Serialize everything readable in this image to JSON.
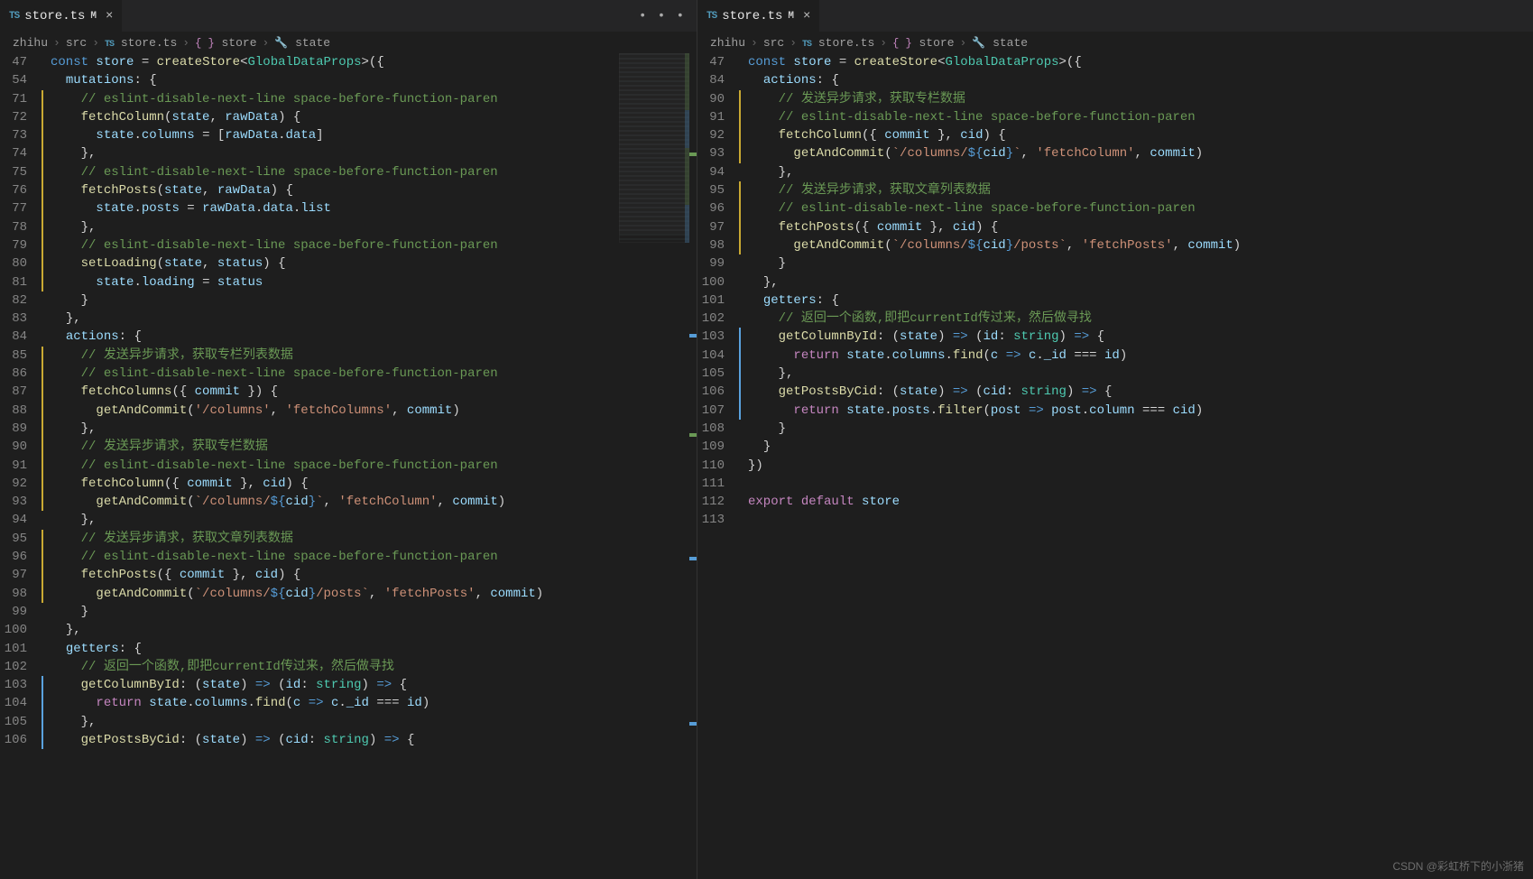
{
  "watermark": "CSDN @彩虹桥下的小浙猪",
  "left": {
    "tab": {
      "icon": "TS",
      "name": "store.ts",
      "modified": "M",
      "close": "×"
    },
    "tab_actions": "• • •",
    "breadcrumb": [
      "zhihu",
      "src",
      {
        "icon": "TS",
        "text": "store.ts"
      },
      {
        "sym": "{}",
        "text": "store"
      },
      {
        "sym": "🔧",
        "text": "state"
      }
    ],
    "lines": [
      {
        "n": 47,
        "stripe": "",
        "html": "<span class='def'>const</span> <span class='var'>store</span> <span class='op'>=</span> <span class='fn'>createStore</span><span class='pun'>&lt;</span><span class='type'>GlobalDataProps</span><span class='pun'>&gt;(</span><span class='pun'>{</span>"
      },
      {
        "n": 54,
        "stripe": "",
        "html": "  <span class='var'>mutations</span><span class='pun'>:</span> <span class='pun'>{</span>"
      },
      {
        "n": 71,
        "stripe": "y",
        "html": "    <span class='cmt'>// eslint-disable-next-line space-before-function-paren</span>"
      },
      {
        "n": 72,
        "stripe": "y",
        "html": "    <span class='fn'>fetchColumn</span><span class='pun'>(</span><span class='var'>state</span><span class='pun'>,</span> <span class='var'>rawData</span><span class='pun'>) {</span>"
      },
      {
        "n": 73,
        "stripe": "y",
        "html": "      <span class='var'>state</span><span class='pun'>.</span><span class='var'>columns</span> <span class='op'>=</span> <span class='pun'>[</span><span class='var'>rawData</span><span class='pun'>.</span><span class='var'>data</span><span class='pun'>]</span>"
      },
      {
        "n": 74,
        "stripe": "y",
        "html": "    <span class='pun'>},</span>"
      },
      {
        "n": 75,
        "stripe": "y",
        "html": "    <span class='cmt'>// eslint-disable-next-line space-before-function-paren</span>"
      },
      {
        "n": 76,
        "stripe": "y",
        "html": "    <span class='fn'>fetchPosts</span><span class='pun'>(</span><span class='var'>state</span><span class='pun'>,</span> <span class='var'>rawData</span><span class='pun'>) {</span>"
      },
      {
        "n": 77,
        "stripe": "y",
        "html": "      <span class='var'>state</span><span class='pun'>.</span><span class='var'>posts</span> <span class='op'>=</span> <span class='var'>rawData</span><span class='pun'>.</span><span class='var'>data</span><span class='pun'>.</span><span class='var'>list</span>"
      },
      {
        "n": 78,
        "stripe": "y",
        "html": "    <span class='pun'>},</span>"
      },
      {
        "n": 79,
        "stripe": "y",
        "html": "    <span class='cmt'>// eslint-disable-next-line space-before-function-paren</span>"
      },
      {
        "n": 80,
        "stripe": "y",
        "html": "    <span class='fn'>setLoading</span><span class='pun'>(</span><span class='var'>state</span><span class='pun'>,</span> <span class='var'>status</span><span class='pun'>) {</span>"
      },
      {
        "n": 81,
        "stripe": "y",
        "html": "      <span class='var'>state</span><span class='pun'>.</span><span class='var'>loading</span> <span class='op'>=</span> <span class='var'>status</span>"
      },
      {
        "n": 82,
        "stripe": "",
        "html": "    <span class='pun'>}</span>"
      },
      {
        "n": 83,
        "stripe": "",
        "html": "  <span class='pun'>},</span>"
      },
      {
        "n": 84,
        "stripe": "",
        "html": "  <span class='var'>actions</span><span class='pun'>:</span> <span class='pun'>{</span>"
      },
      {
        "n": 85,
        "stripe": "y",
        "html": "    <span class='cmt'>// 发送异步请求，获取专栏列表数据</span>"
      },
      {
        "n": 86,
        "stripe": "y",
        "html": "    <span class='cmt'>// eslint-disable-next-line space-before-function-paren</span>"
      },
      {
        "n": 87,
        "stripe": "y",
        "html": "    <span class='fn'>fetchColumns</span><span class='pun'>({ </span><span class='var'>commit</span><span class='pun'> }) {</span>"
      },
      {
        "n": 88,
        "stripe": "y",
        "html": "      <span class='fn'>getAndCommit</span><span class='pun'>(</span><span class='str'>'/columns'</span><span class='pun'>,</span> <span class='str'>'fetchColumns'</span><span class='pun'>,</span> <span class='var'>commit</span><span class='pun'>)</span>"
      },
      {
        "n": 89,
        "stripe": "y",
        "html": "    <span class='pun'>},</span>"
      },
      {
        "n": 90,
        "stripe": "y",
        "html": "    <span class='cmt'>// 发送异步请求，获取专栏数据</span>"
      },
      {
        "n": 91,
        "stripe": "y",
        "html": "    <span class='cmt'>// eslint-disable-next-line space-before-function-paren</span>"
      },
      {
        "n": 92,
        "stripe": "y",
        "html": "    <span class='fn'>fetchColumn</span><span class='pun'>({ </span><span class='var'>commit</span><span class='pun'> }, </span><span class='var'>cid</span><span class='pun'>) {</span>"
      },
      {
        "n": 93,
        "stripe": "y",
        "html": "      <span class='fn'>getAndCommit</span><span class='pun'>(</span><span class='str'>`/columns/</span><span class='def'>${</span><span class='var'>cid</span><span class='def'>}</span><span class='str'>`</span><span class='pun'>,</span> <span class='str'>'fetchColumn'</span><span class='pun'>,</span> <span class='var'>commit</span><span class='pun'>)</span>"
      },
      {
        "n": 94,
        "stripe": "",
        "html": "    <span class='pun'>},</span>"
      },
      {
        "n": 95,
        "stripe": "y",
        "html": "    <span class='cmt'>// 发送异步请求，获取文章列表数据</span>"
      },
      {
        "n": 96,
        "stripe": "y",
        "html": "    <span class='cmt'>// eslint-disable-next-line space-before-function-paren</span>"
      },
      {
        "n": 97,
        "stripe": "y",
        "html": "    <span class='fn'>fetchPosts</span><span class='pun'>({ </span><span class='var'>commit</span><span class='pun'> }, </span><span class='var'>cid</span><span class='pun'>) {</span>"
      },
      {
        "n": 98,
        "stripe": "y",
        "html": "      <span class='fn'>getAndCommit</span><span class='pun'>(</span><span class='str'>`/columns/</span><span class='def'>${</span><span class='var'>cid</span><span class='def'>}</span><span class='str'>/posts`</span><span class='pun'>,</span> <span class='str'>'fetchPosts'</span><span class='pun'>,</span> <span class='var'>commit</span><span class='pun'>)</span>"
      },
      {
        "n": 99,
        "stripe": "",
        "html": "    <span class='pun'>}</span>"
      },
      {
        "n": 100,
        "stripe": "",
        "html": "  <span class='pun'>},</span>"
      },
      {
        "n": 101,
        "stripe": "",
        "html": "  <span class='var'>getters</span><span class='pun'>:</span> <span class='pun'>{</span>"
      },
      {
        "n": 102,
        "stripe": "",
        "html": "    <span class='cmt'>// 返回一个函数,即把currentId传过来，然后做寻找</span>"
      },
      {
        "n": 103,
        "stripe": "b",
        "html": "    <span class='fn'>getColumnById</span><span class='pun'>:</span> <span class='pun'>(</span><span class='var'>state</span><span class='pun'>)</span> <span class='def'>=&gt;</span> <span class='pun'>(</span><span class='var'>id</span><span class='pun'>:</span> <span class='type'>string</span><span class='pun'>)</span> <span class='def'>=&gt;</span> <span class='pun'>{</span>"
      },
      {
        "n": 104,
        "stripe": "b",
        "html": "      <span class='kw'>return</span> <span class='var'>state</span><span class='pun'>.</span><span class='var'>columns</span><span class='pun'>.</span><span class='fn'>find</span><span class='pun'>(</span><span class='var'>c</span> <span class='def'>=&gt;</span> <span class='var'>c</span><span class='pun'>.</span><span class='var'>_id</span> <span class='op'>===</span> <span class='var'>id</span><span class='pun'>)</span>"
      },
      {
        "n": 105,
        "stripe": "b",
        "html": "    <span class='pun'>},</span>"
      },
      {
        "n": 106,
        "stripe": "b",
        "html": "    <span class='fn'>getPostsByCid</span><span class='pun'>:</span> <span class='pun'>(</span><span class='var'>state</span><span class='pun'>)</span> <span class='def'>=&gt;</span> <span class='pun'>(</span><span class='var'>cid</span><span class='pun'>:</span> <span class='type'>string</span><span class='pun'>)</span> <span class='def'>=&gt;</span> <span class='pun'>{</span>"
      }
    ]
  },
  "right": {
    "tab": {
      "icon": "TS",
      "name": "store.ts",
      "modified": "M",
      "close": "×"
    },
    "breadcrumb": [
      "zhihu",
      "src",
      {
        "icon": "TS",
        "text": "store.ts"
      },
      {
        "sym": "{}",
        "text": "store"
      },
      {
        "sym": "🔧",
        "text": "state"
      }
    ],
    "lines": [
      {
        "n": 47,
        "stripe": "",
        "html": "<span class='def'>const</span> <span class='var'>store</span> <span class='op'>=</span> <span class='fn'>createStore</span><span class='pun'>&lt;</span><span class='type'>GlobalDataProps</span><span class='pun'>&gt;(</span><span class='pun'>{</span>"
      },
      {
        "n": 84,
        "stripe": "",
        "html": "  <span class='var'>actions</span><span class='pun'>:</span> <span class='pun'>{</span>"
      },
      {
        "n": 90,
        "stripe": "y",
        "html": "    <span class='cmt'>// 发送异步请求，获取专栏数据</span>"
      },
      {
        "n": 91,
        "stripe": "y",
        "html": "    <span class='cmt'>// eslint-disable-next-line space-before-function-paren</span>"
      },
      {
        "n": 92,
        "stripe": "y",
        "html": "    <span class='fn'>fetchColumn</span><span class='pun'>({ </span><span class='var'>commit</span><span class='pun'> }, </span><span class='var'>cid</span><span class='pun'>) {</span>"
      },
      {
        "n": 93,
        "stripe": "y",
        "html": "      <span class='fn'>getAndCommit</span><span class='pun'>(</span><span class='str'>`/columns/</span><span class='def'>${</span><span class='var'>cid</span><span class='def'>}</span><span class='str'>`</span><span class='pun'>,</span> <span class='str'>'fetchColumn'</span><span class='pun'>,</span> <span class='var'>commit</span><span class='pun'>)</span>"
      },
      {
        "n": 94,
        "stripe": "",
        "html": "    <span class='pun'>},</span>"
      },
      {
        "n": 95,
        "stripe": "y",
        "html": "    <span class='cmt'>// 发送异步请求，获取文章列表数据</span>"
      },
      {
        "n": 96,
        "stripe": "y",
        "html": "    <span class='cmt'>// eslint-disable-next-line space-before-function-paren</span>"
      },
      {
        "n": 97,
        "stripe": "y",
        "html": "    <span class='fn'>fetchPosts</span><span class='pun'>({ </span><span class='var'>commit</span><span class='pun'> }, </span><span class='var'>cid</span><span class='pun'>) {</span>"
      },
      {
        "n": 98,
        "stripe": "y",
        "html": "      <span class='fn'>getAndCommit</span><span class='pun'>(</span><span class='str'>`/columns/</span><span class='def'>${</span><span class='var'>cid</span><span class='def'>}</span><span class='str'>/posts`</span><span class='pun'>,</span> <span class='str'>'fetchPosts'</span><span class='pun'>,</span> <span class='var'>commit</span><span class='pun'>)</span>"
      },
      {
        "n": 99,
        "stripe": "",
        "html": "    <span class='pun'>}</span>"
      },
      {
        "n": 100,
        "stripe": "",
        "html": "  <span class='pun'>},</span>"
      },
      {
        "n": 101,
        "stripe": "",
        "html": "  <span class='var'>getters</span><span class='pun'>:</span> <span class='pun'>{</span>"
      },
      {
        "n": 102,
        "stripe": "",
        "html": "    <span class='cmt'>// 返回一个函数,即把currentId传过来，然后做寻找</span>"
      },
      {
        "n": 103,
        "stripe": "b",
        "html": "    <span class='fn'>getColumnById</span><span class='pun'>:</span> <span class='pun'>(</span><span class='var'>state</span><span class='pun'>)</span> <span class='def'>=&gt;</span> <span class='pun'>(</span><span class='var'>id</span><span class='pun'>:</span> <span class='type'>string</span><span class='pun'>)</span> <span class='def'>=&gt;</span> <span class='pun'>{</span>"
      },
      {
        "n": 104,
        "stripe": "b",
        "html": "      <span class='kw'>return</span> <span class='var'>state</span><span class='pun'>.</span><span class='var'>columns</span><span class='pun'>.</span><span class='fn'>find</span><span class='pun'>(</span><span class='var'>c</span> <span class='def'>=&gt;</span> <span class='var'>c</span><span class='pun'>.</span><span class='var'>_id</span> <span class='op'>===</span> <span class='var'>id</span><span class='pun'>)</span>"
      },
      {
        "n": 105,
        "stripe": "b",
        "html": "    <span class='pun'>},</span>"
      },
      {
        "n": 106,
        "stripe": "b",
        "html": "    <span class='fn'>getPostsByCid</span><span class='pun'>:</span> <span class='pun'>(</span><span class='var'>state</span><span class='pun'>)</span> <span class='def'>=&gt;</span> <span class='pun'>(</span><span class='var'>cid</span><span class='pun'>:</span> <span class='type'>string</span><span class='pun'>)</span> <span class='def'>=&gt;</span> <span class='pun'>{</span>"
      },
      {
        "n": 107,
        "stripe": "b",
        "html": "      <span class='kw'>return</span> <span class='var'>state</span><span class='pun'>.</span><span class='var'>posts</span><span class='pun'>.</span><span class='fn'>filter</span><span class='pun'>(</span><span class='var'>post</span> <span class='def'>=&gt;</span> <span class='var'>post</span><span class='pun'>.</span><span class='var'>column</span> <span class='op'>===</span> <span class='var'>cid</span><span class='pun'>)</span>"
      },
      {
        "n": 108,
        "stripe": "",
        "html": "    <span class='pun'>}</span>"
      },
      {
        "n": 109,
        "stripe": "",
        "html": "  <span class='pun'>}</span>"
      },
      {
        "n": 110,
        "stripe": "",
        "html": "<span class='pun'>})</span>"
      },
      {
        "n": 111,
        "stripe": "",
        "html": ""
      },
      {
        "n": 112,
        "stripe": "",
        "html": "<span class='kw'>export</span> <span class='kw'>default</span> <span class='var'>store</span>"
      },
      {
        "n": 113,
        "stripe": "",
        "html": ""
      }
    ]
  }
}
